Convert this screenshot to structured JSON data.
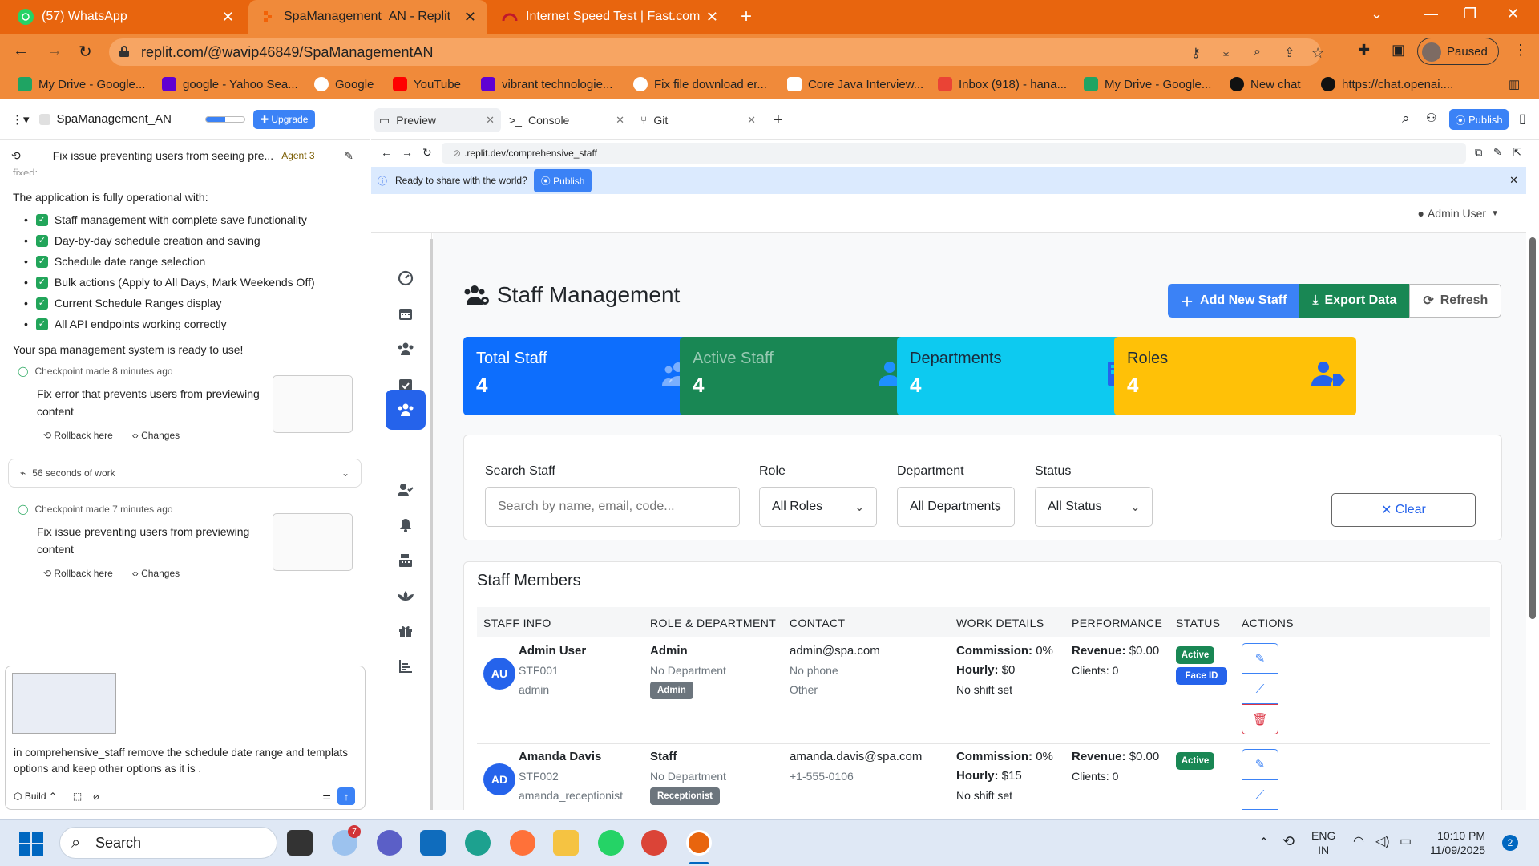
{
  "browser": {
    "tabs": [
      {
        "title": "(57) WhatsApp"
      },
      {
        "title": "SpaManagement_AN - Replit"
      },
      {
        "title": "Internet Speed Test | Fast.com"
      }
    ],
    "url": "replit.com/@wavip46849/SpaManagementAN",
    "profile_status": "Paused",
    "bookmarks": [
      "My Drive - Google...",
      "google - Yahoo Sea...",
      "Google",
      "YouTube",
      "vibrant technologie...",
      "Fix file download er...",
      "Core Java Interview...",
      "Inbox (918) - hana...",
      "My Drive - Google...",
      "New chat",
      "https://chat.openai...."
    ]
  },
  "replit": {
    "project_name": "SpaManagement_AN",
    "upgrade_label": "Upgrade",
    "thread_title": "Fix issue preventing users from seeing pre...",
    "agent_label": "Agent 3",
    "cut_text": "fixed:",
    "intro": "The application is fully operational with:",
    "checklist": [
      "Staff management with complete save functionality",
      "Day-by-day schedule creation and saving",
      "Schedule date range selection",
      "Bulk actions (Apply to All Days, Mark Weekends Off)",
      "Current Schedule Ranges display",
      "All API endpoints working correctly"
    ],
    "ready_text": "Your spa management system is ready to use!",
    "checkpoints": [
      {
        "meta": "Checkpoint made 8 minutes ago",
        "text": "Fix error that prevents users from previewing content",
        "rollback": "Rollback here",
        "changes": "Changes"
      },
      {
        "meta": "Checkpoint made 7 minutes ago",
        "text": "Fix issue preventing users from previewing content",
        "rollback": "Rollback here",
        "changes": "Changes"
      }
    ],
    "work_label": "56 seconds of work",
    "composer_text": "in comprehensive_staff remove the schedule date range and templats options and keep other options as it is .",
    "build_label": "Build"
  },
  "preview": {
    "tabs": [
      "Preview",
      "Console",
      "Git"
    ],
    "publish_label": "Publish",
    "url": ".replit.dev/comprehensive_staff",
    "banner_text": "Ready to share with the world?",
    "banner_button": "Publish"
  },
  "app": {
    "user_menu": "Admin User",
    "page_title": "Staff Management",
    "buttons": {
      "add": "Add New Staff",
      "export": "Export Data",
      "refresh": "Refresh"
    },
    "stats": [
      {
        "label": "Total Staff",
        "value": "4",
        "color": "#0d6efd"
      },
      {
        "label": "Active Staff",
        "value": "4",
        "color": "#198754"
      },
      {
        "label": "Departments",
        "value": "4",
        "color": "#0dcaf0"
      },
      {
        "label": "Roles",
        "value": "4",
        "color": "#ffc107"
      }
    ],
    "filters": {
      "search_label": "Search Staff",
      "search_placeholder": "Search by name, email, code...",
      "role_label": "Role",
      "role_value": "All Roles",
      "department_label": "Department",
      "department_value": "All Departments",
      "status_label": "Status",
      "status_value": "All Status",
      "clear_label": "Clear"
    },
    "table": {
      "title": "Staff Members",
      "headers": [
        "STAFF INFO",
        "ROLE & DEPARTMENT",
        "CONTACT",
        "WORK DETAILS",
        "PERFORMANCE",
        "STATUS",
        "ACTIONS"
      ],
      "rows": [
        {
          "initials": "AU",
          "name": "Admin User",
          "code": "STF001",
          "username": "admin",
          "role": "Admin",
          "department": "No Department",
          "role_badge": "Admin",
          "email": "admin@spa.com",
          "phone": "No phone",
          "gender": "Other",
          "commission_label": "Commission:",
          "commission": "0%",
          "hourly_label": "Hourly:",
          "hourly": "$0",
          "shift": "No shift set",
          "revenue_label": "Revenue:",
          "revenue": "$0.00",
          "clients": "Clients: 0",
          "status": "Active",
          "extra_badge": "Face ID"
        },
        {
          "initials": "AD",
          "name": "Amanda Davis",
          "code": "STF002",
          "username": "amanda_receptionist",
          "role": "Staff",
          "department": "No Department",
          "role_badge": "Receptionist",
          "email": "amanda.davis@spa.com",
          "phone": "+1-555-0106",
          "commission_label": "Commission:",
          "commission": "0%",
          "hourly_label": "Hourly:",
          "hourly": "$15",
          "shift": "No shift set",
          "revenue_label": "Revenue:",
          "revenue": "$0.00",
          "clients": "Clients: 0",
          "status": "Active"
        }
      ]
    }
  },
  "taskbar": {
    "search_label": "Search",
    "weather_badge": "7",
    "lang_top": "ENG",
    "lang_bottom": "IN",
    "time": "10:10 PM",
    "date": "11/09/2025",
    "notifications": "2"
  }
}
